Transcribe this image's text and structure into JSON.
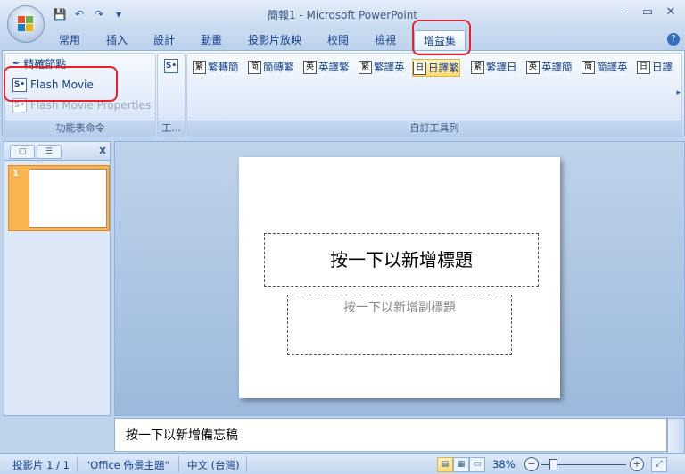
{
  "window": {
    "title": "簡報1 - Microsoft PowerPoint",
    "controls": {
      "minimize": "–",
      "restore": "▭",
      "close": "✕"
    }
  },
  "quick_access": {
    "save": "💾",
    "undo": "↶",
    "redo": "↷",
    "customize": "▾"
  },
  "tabs": [
    {
      "label": "常用"
    },
    {
      "label": "插入"
    },
    {
      "label": "設計"
    },
    {
      "label": "動畫"
    },
    {
      "label": "投影片放映"
    },
    {
      "label": "校閱"
    },
    {
      "label": "檢視"
    },
    {
      "label": "增益集",
      "active": true
    }
  ],
  "help": "?",
  "ribbon": {
    "menu_commands": {
      "label": "功能表命令",
      "items": [
        {
          "label": "精確節點",
          "icon": "pen-icon",
          "enabled": true
        },
        {
          "label": "Flash Movie",
          "icon": "flash-icon",
          "enabled": true
        },
        {
          "label": "Flash Movie Properties",
          "icon": "flash-icon",
          "enabled": false
        }
      ]
    },
    "toolbar_group": {
      "label": "工..."
    },
    "custom_toolbar": {
      "label": "自訂工具列",
      "commands": [
        {
          "box": "繁",
          "label": "繁轉簡"
        },
        {
          "box": "简",
          "label": "簡轉繁"
        },
        {
          "box": "英",
          "label": "英譯繁"
        },
        {
          "box": "繁",
          "label": "繁譯英"
        },
        {
          "box": "日",
          "label": "日譯繁",
          "selected": true
        },
        {
          "box": "繁",
          "label": "繁譯日"
        },
        {
          "box": "英",
          "label": "英譯簡"
        },
        {
          "box": "简",
          "label": "簡譯英"
        },
        {
          "box": "日",
          "label": "日譯"
        }
      ]
    }
  },
  "left_pane": {
    "close": "x",
    "slide_number": "1"
  },
  "slide": {
    "title_placeholder": "按一下以新增標題",
    "subtitle_placeholder": "按一下以新增副標題"
  },
  "notes": {
    "placeholder": "按一下以新增備忘稿"
  },
  "status": {
    "slide_count": "投影片 1 / 1",
    "theme": "\"Office 佈景主題\"",
    "language": "中文 (台灣)",
    "zoom": "38%",
    "zoom_percent": 38
  }
}
